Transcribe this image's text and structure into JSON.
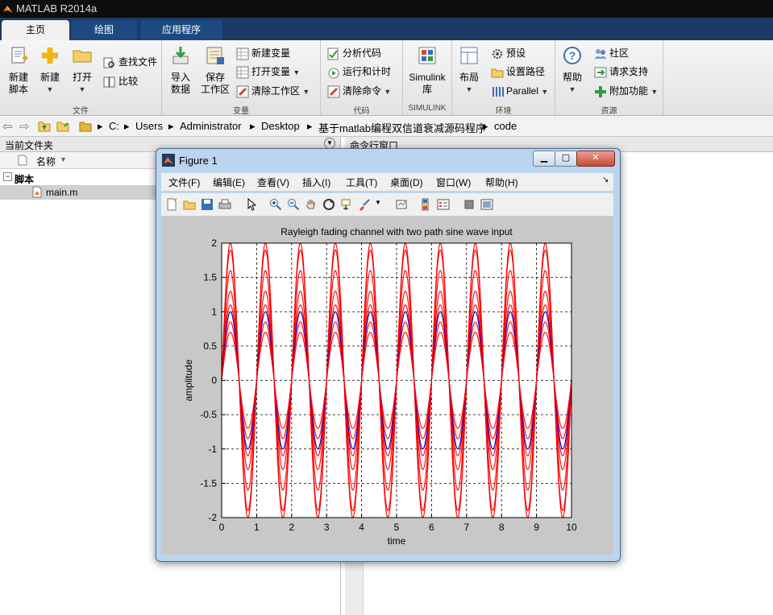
{
  "app": {
    "title": "MATLAB R2014a"
  },
  "tabs": [
    "主页",
    "绘图",
    "应用程序"
  ],
  "ribbon": {
    "file": {
      "label": "文件",
      "new_script": [
        "新建",
        "脚本"
      ],
      "new": "新建",
      "open": "打开",
      "find_files": "查找文件",
      "compare": "比较"
    },
    "variable": {
      "label": "变量",
      "import": [
        "导入",
        "数据"
      ],
      "save": [
        "保存",
        "工作区"
      ],
      "new_var": "新建变量",
      "open_var": "打开变量",
      "clear_ws": "清除工作区"
    },
    "code": {
      "label": "代码",
      "analyze": "分析代码",
      "run_time": "运行和计时",
      "clear_cmd": "清除命令"
    },
    "simulink": {
      "label": "SIMULINK",
      "lib": [
        "Simulink",
        "库"
      ]
    },
    "env": {
      "label": "环境",
      "layout": "布局",
      "prefs": "预设",
      "set_path": "设置路径",
      "parallel": "Parallel"
    },
    "resources": {
      "label": "资源",
      "help": "帮助",
      "community": "社区",
      "support": "请求支持",
      "addons": "附加功能"
    }
  },
  "path": [
    "C:",
    "Users",
    "Administrator",
    "Desktop",
    "基于matlab编程双信道衰减源码程序",
    "code"
  ],
  "left_panel": {
    "title": "当前文件夹",
    "col_name": "名称",
    "section": "脚本",
    "file": "main.m"
  },
  "cmd_panel": {
    "title": "命令行窗口"
  },
  "figure": {
    "title": "Figure 1",
    "menu": [
      "文件(F)",
      "编辑(E)",
      "查看(V)",
      "插入(I)",
      "工具(T)",
      "桌面(D)",
      "窗口(W)",
      "帮助(H)"
    ]
  },
  "chart_data": {
    "type": "line",
    "title": "Rayleigh fading channel with two path sine wave input",
    "xlabel": "time",
    "ylabel": "amplitude",
    "xlim": [
      0,
      10
    ],
    "ylim": [
      -2,
      2
    ],
    "xticks": [
      "0",
      "1",
      "2",
      "3",
      "4",
      "5",
      "6",
      "7",
      "8",
      "9",
      "10"
    ],
    "yticks": [
      "2",
      "1.5",
      "1",
      "0.5",
      "0",
      "-0.5",
      "-1",
      "-1.5",
      "-2"
    ],
    "grid": true,
    "frequency_hz": 1,
    "x": [
      0,
      0.5,
      1,
      1.5,
      2,
      2.5,
      3,
      3.5,
      4,
      4.5,
      5,
      5.5,
      6,
      6.5,
      7,
      7.5,
      8,
      8.5,
      9,
      9.5,
      10
    ],
    "series": [
      {
        "color": "#ff0000",
        "amplitude": 2.0,
        "values": [
          0,
          2,
          0,
          -2,
          0,
          2,
          0,
          -2,
          0,
          2,
          0,
          -2,
          0,
          2,
          0,
          -2,
          0,
          2,
          0,
          -2,
          0
        ]
      },
      {
        "color": "#ff0000",
        "amplitude": 1.9,
        "values": [
          0,
          1.9,
          0,
          -1.9,
          0,
          1.9,
          0,
          -1.9,
          0,
          1.9,
          0,
          -1.9,
          0,
          1.9,
          0,
          -1.9,
          0,
          1.9,
          0,
          -1.9,
          0
        ]
      },
      {
        "color": "#ff0000",
        "amplitude": 1.6,
        "values": [
          0,
          1.6,
          0,
          -1.6,
          0,
          1.6,
          0,
          -1.6,
          0,
          1.6,
          0,
          -1.6,
          0,
          1.6,
          0,
          -1.6,
          0,
          1.6,
          0,
          -1.6,
          0
        ]
      },
      {
        "color": "#ff0000",
        "amplitude": 1.3,
        "values": [
          0,
          1.3,
          0,
          -1.3,
          0,
          1.3,
          0,
          -1.3,
          0,
          1.3,
          0,
          -1.3,
          0,
          1.3,
          0,
          -1.3,
          0,
          1.3,
          0,
          -1.3,
          0
        ]
      },
      {
        "color": "#ff0000",
        "amplitude": 1.1,
        "values": [
          0,
          1.1,
          0,
          -1.1,
          0,
          1.1,
          0,
          -1.1,
          0,
          1.1,
          0,
          -1.1,
          0,
          1.1,
          0,
          -1.1,
          0,
          1.1,
          0,
          -1.1,
          0
        ]
      },
      {
        "color": "#0000cc",
        "amplitude": 1.0,
        "values": [
          0,
          1,
          0,
          -1,
          0,
          1,
          0,
          -1,
          0,
          1,
          0,
          -1,
          0,
          1,
          0,
          -1,
          0,
          1,
          0,
          -1,
          0
        ]
      },
      {
        "color": "#ff0000",
        "amplitude": 0.85,
        "values": [
          0,
          0.85,
          0,
          -0.85,
          0,
          0.85,
          0,
          -0.85,
          0,
          0.85,
          0,
          -0.85,
          0,
          0.85,
          0,
          -0.85,
          0,
          0.85,
          0,
          -0.85,
          0
        ]
      },
      {
        "color": "#ff0000",
        "amplitude": 0.7,
        "values": [
          0,
          0.7,
          0,
          -0.7,
          0,
          0.7,
          0,
          -0.7,
          0,
          0.7,
          0,
          -0.7,
          0,
          0.7,
          0,
          -0.7,
          0,
          0.7,
          0,
          -0.7,
          0
        ]
      }
    ]
  }
}
